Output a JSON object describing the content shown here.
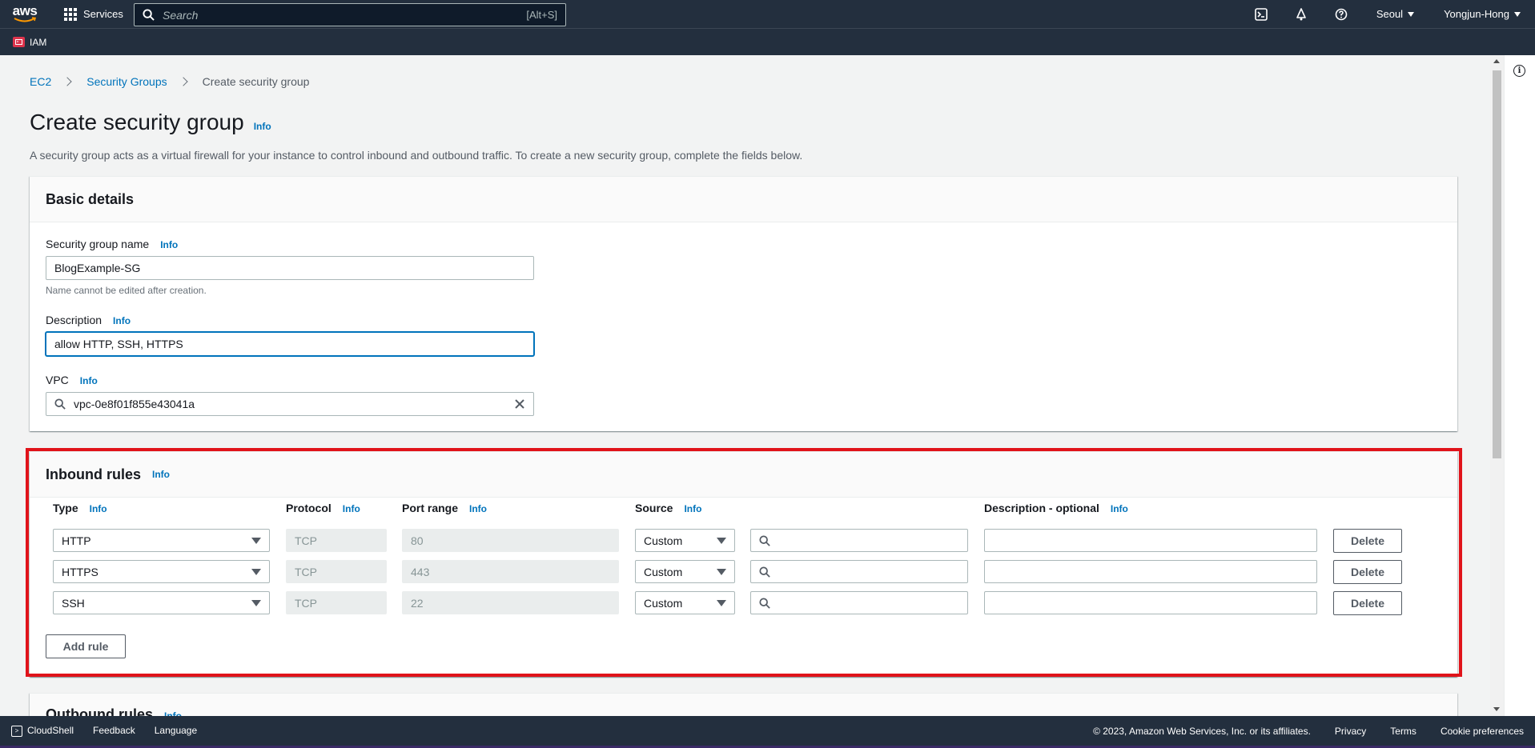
{
  "topnav": {
    "logo_text": "aws",
    "services_label": "Services",
    "search_placeholder": "Search",
    "search_shortcut": "[Alt+S]",
    "region_label": "Seoul",
    "account_label": "Yongjun-Hong"
  },
  "subnav": {
    "service_label": "IAM"
  },
  "breadcrumb": {
    "items": [
      "EC2",
      "Security Groups",
      "Create security group"
    ]
  },
  "page": {
    "title": "Create security group",
    "info_label": "Info",
    "description": "A security group acts as a virtual firewall for your instance to control inbound and outbound traffic. To create a new security group, complete the fields below."
  },
  "basic_details": {
    "heading": "Basic details",
    "name_label": "Security group name",
    "name_value": "BlogExample-SG",
    "name_hint": "Name cannot be edited after creation.",
    "description_label": "Description",
    "description_value": "allow HTTP, SSH, HTTPS",
    "vpc_label": "VPC",
    "vpc_value": "vpc-0e8f01f855e43041a"
  },
  "inbound": {
    "heading": "Inbound rules",
    "columns": [
      "Type",
      "Protocol",
      "Port range",
      "Source",
      "Description - optional"
    ],
    "rules": [
      {
        "type": "HTTP",
        "protocol": "TCP",
        "port": "80",
        "source": "Custom",
        "delete_label": "Delete"
      },
      {
        "type": "HTTPS",
        "protocol": "TCP",
        "port": "443",
        "source": "Custom",
        "delete_label": "Delete"
      },
      {
        "type": "SSH",
        "protocol": "TCP",
        "port": "22",
        "source": "Custom",
        "delete_label": "Delete"
      }
    ],
    "add_rule_label": "Add rule"
  },
  "outbound": {
    "heading": "Outbound rules"
  },
  "footer": {
    "cloudshell": "CloudShell",
    "feedback": "Feedback",
    "language": "Language",
    "copyright": "© 2023, Amazon Web Services, Inc. or its affiliates.",
    "privacy": "Privacy",
    "terms": "Terms",
    "cookies": "Cookie preferences"
  },
  "colors": {
    "nav_bg": "#232f3e",
    "link": "#0073bb",
    "highlight": "#e0131a"
  }
}
